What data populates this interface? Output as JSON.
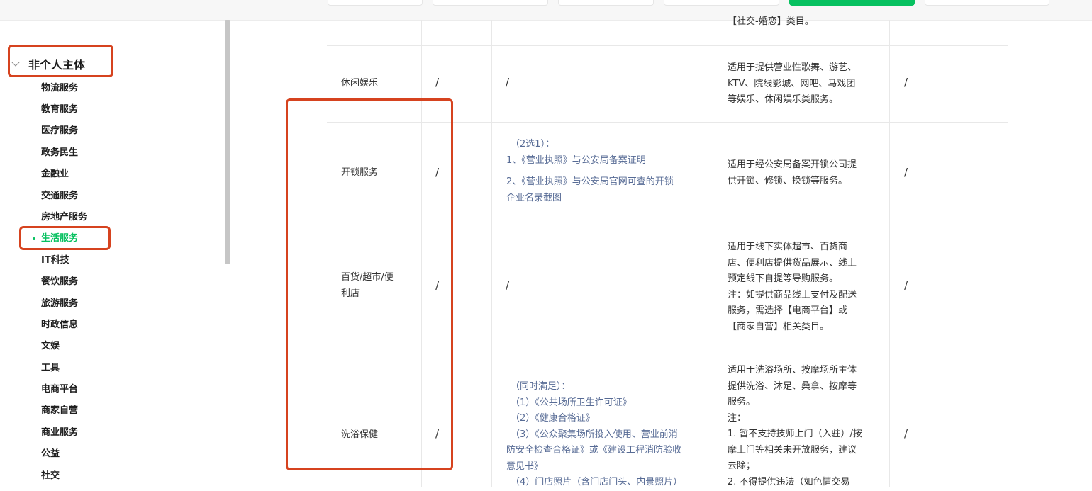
{
  "sidebar": {
    "group_title": "非个人主体",
    "items": [
      "物流服务",
      "教育服务",
      "医疗服务",
      "政务民生",
      "金融业",
      "交通服务",
      "房地产服务",
      "生活服务",
      "IT科技",
      "餐饮服务",
      "旅游服务",
      "时政信息",
      "文娱",
      "工具",
      "电商平台",
      "商家自营",
      "商业服务",
      "公益",
      "社交"
    ],
    "active_item": "生活服务"
  },
  "table": {
    "top_partial_text": "【社交-婚恋】类目。",
    "rows": [
      {
        "name": "休闲娱乐",
        "col2": "/",
        "qual": "/",
        "desc": [
          "适用于提供营业性歌舞、游艺、",
          "KTV、院线影城、网吧、马戏团",
          "等娱乐、休闲娱乐类服务。"
        ],
        "col5": "/"
      },
      {
        "name": "开锁服务",
        "col2": "/",
        "qual_lines": [
          "（2选1）：",
          "1、《营业执照》与公安局备案证明",
          "2、《营业执照》与公安局官网可查的开锁",
          "企业名录截图"
        ],
        "desc": [
          "适用于经公安局备案开锁公司提",
          "供开锁、修锁、换锁等服务。"
        ],
        "col5": "/"
      },
      {
        "name_lines": [
          "百货/超市/便",
          "利店"
        ],
        "col2": "/",
        "qual": "/",
        "desc": [
          "适用于线下实体超市、百货商",
          "店、便利店提供货品展示、线上",
          "预定线下自提等导购服务。",
          "注：如提供商品线上支付及配送",
          "服务，需选择【电商平台】或",
          "【商家自营】相关类目。"
        ],
        "col5": "/"
      },
      {
        "name": "洗浴保健",
        "col2": "/",
        "qual_lines": [
          "（同时满足）：",
          "（1）《公共场所卫生许可证》",
          "（2）《健康合格证》",
          "（3）《公众聚集场所投入使用、营业前消",
          "防安全检查合格证》或《建设工程消防验收",
          "意见书》",
          "（4）门店照片（含门店门头、内景照片）"
        ],
        "desc": [
          "适用于洗浴场所、按摩场所主体",
          "提供洗浴、沐足、桑拿、按摩等",
          "服务。",
          "注：",
          "1. 暂不支持技师上门（入驻）/按",
          "摩上门等相关未开放服务，建议",
          "去除；",
          "2. 不得提供违法（如色情交易"
        ],
        "col5": "/"
      }
    ]
  },
  "colors": {
    "accent": "#07c160",
    "annotation": "#d6431f",
    "link": "#576b95"
  }
}
